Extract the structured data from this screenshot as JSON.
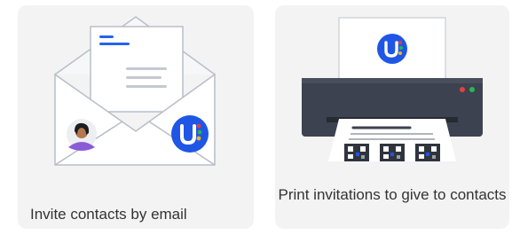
{
  "cards": {
    "email": {
      "label": "Invite contacts by email",
      "icon": "envelope-icon"
    },
    "print": {
      "label": "Print invitations to give to contacts",
      "icon": "printer-icon"
    }
  },
  "brand": {
    "logo_letter": "U",
    "color": "#1f56e6",
    "accent_red": "#e2413b",
    "accent_green": "#2cb452",
    "accent_yellow": "#f3b51a"
  },
  "colors": {
    "card_bg": "#f3f3f4",
    "envelope_stroke": "#b8bec8",
    "printer_body": "#3d4250",
    "text": "#333333"
  }
}
